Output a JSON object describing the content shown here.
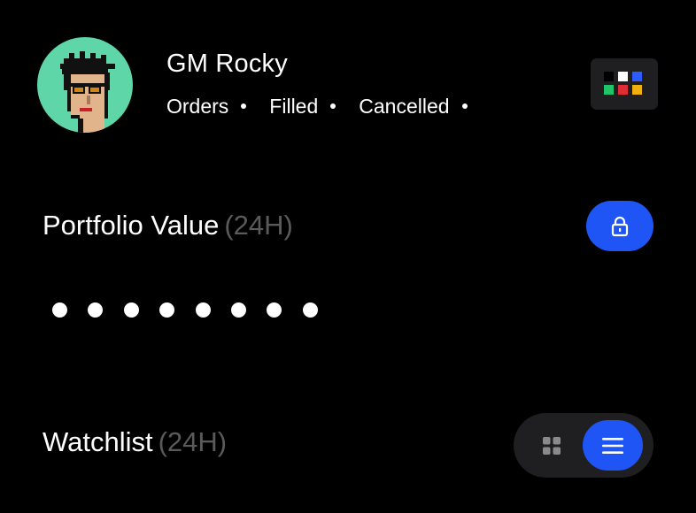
{
  "header": {
    "avatar_icon": "pixel-punk-avatar",
    "avatar_bg": "#5fd6a8",
    "greeting": "GM Rocky",
    "order_links": [
      {
        "label": "Orders"
      },
      {
        "label": "Filled"
      },
      {
        "label": "Cancelled"
      }
    ],
    "app_switch_icon": "color-grid-icon"
  },
  "portfolio": {
    "title": "Portfolio Value",
    "period": "(24H)",
    "lock_icon": "lock-icon",
    "masked_value": "••••••••"
  },
  "watchlist": {
    "title": "Watchlist",
    "period": "(24H)",
    "view_toggle": {
      "options": [
        "grid-icon",
        "list-icon"
      ],
      "selected": "list-icon"
    }
  },
  "colors": {
    "background": "#000000",
    "accent": "#1f55f5",
    "muted_text": "#5a5a5a",
    "surface": "#1f1f21"
  }
}
